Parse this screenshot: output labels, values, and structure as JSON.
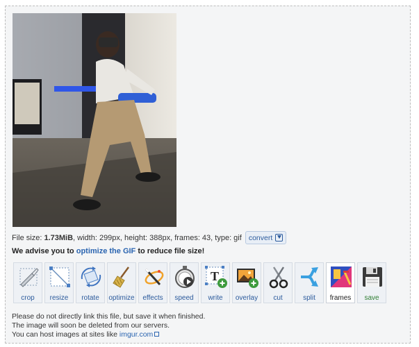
{
  "file_info": {
    "size_label": "File size:",
    "size_value": "1.73MiB",
    "details": ", width: 299px, height: 388px, frames: 43, type: gif",
    "convert_label": "convert"
  },
  "advice": {
    "before": "We advise you to ",
    "link": "optimize the GIF",
    "after": " to reduce file size!"
  },
  "tools": [
    {
      "label": "crop",
      "icon": "crop-icon"
    },
    {
      "label": "resize",
      "icon": "resize-icon"
    },
    {
      "label": "rotate",
      "icon": "rotate-icon"
    },
    {
      "label": "optimize",
      "icon": "broom-icon"
    },
    {
      "label": "effects",
      "icon": "magic-wand-icon"
    },
    {
      "label": "speed",
      "icon": "stopwatch-icon"
    },
    {
      "label": "write",
      "icon": "text-add-icon"
    },
    {
      "label": "overlay",
      "icon": "image-add-icon"
    },
    {
      "label": "cut",
      "icon": "scissors-icon"
    },
    {
      "label": "split",
      "icon": "split-arrow-icon"
    },
    {
      "label": "frames",
      "icon": "frames-icon",
      "active": true
    },
    {
      "label": "save",
      "icon": "floppy-disk-icon"
    }
  ],
  "notes": {
    "line1": "Please do not directly link this file, but save it when finished.",
    "line2": "The image will soon be deleted from our servers.",
    "line3_prefix": "You can host images at sites like ",
    "line3_link": "imgur.com"
  },
  "colors": {
    "link": "#2a64b0",
    "accent": "#2b5a9c",
    "save": "#2e7d32"
  }
}
